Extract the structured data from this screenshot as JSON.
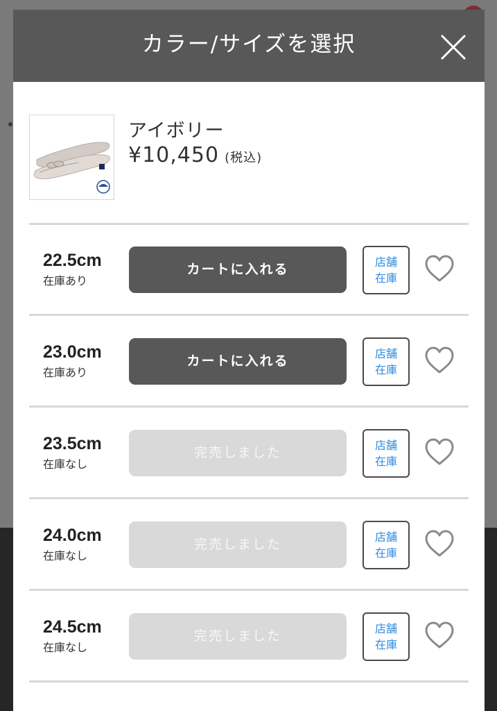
{
  "modal": {
    "title": "カラー/サイズを選択",
    "close_icon": "close-icon"
  },
  "product": {
    "color": "アイボリー",
    "price": "¥10,450",
    "tax_note": "(税込)"
  },
  "sizes": [
    {
      "size": "22.5cm",
      "stock": "在庫あり",
      "button": "カートに入れる",
      "available": true,
      "store_line1": "店舗",
      "store_line2": "在庫"
    },
    {
      "size": "23.0cm",
      "stock": "在庫あり",
      "button": "カートに入れる",
      "available": true,
      "store_line1": "店舗",
      "store_line2": "在庫"
    },
    {
      "size": "23.5cm",
      "stock": "在庫なし",
      "button": "完売しました",
      "available": false,
      "store_line1": "店舗",
      "store_line2": "在庫"
    },
    {
      "size": "24.0cm",
      "stock": "在庫なし",
      "button": "完売しました",
      "available": false,
      "store_line1": "店舗",
      "store_line2": "在庫"
    },
    {
      "size": "24.5cm",
      "stock": "在庫なし",
      "button": "完売しました",
      "available": false,
      "store_line1": "店舗",
      "store_line2": "在庫"
    }
  ],
  "colors": {
    "header": "#585858",
    "cart_active": "#585858",
    "cart_soldout": "#d9d9d9",
    "store_link": "#2f8be0"
  }
}
